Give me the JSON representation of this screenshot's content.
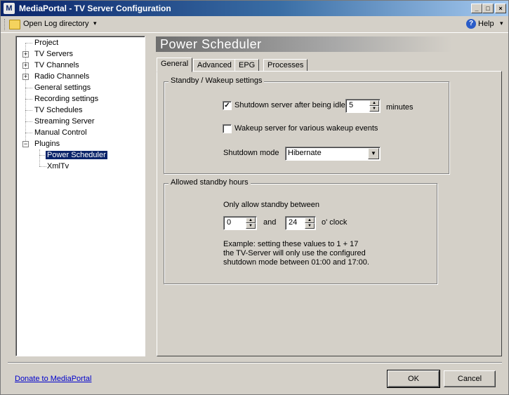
{
  "window": {
    "title": "MediaPortal - TV Server Configuration",
    "app_icon_glyph": "M",
    "minimize_glyph": "_",
    "maximize_glyph": "□",
    "close_glyph": "×"
  },
  "toolbar": {
    "open_log_label": "Open Log directory",
    "dropdown_glyph": "▾",
    "help_label": "Help",
    "help_icon_glyph": "?"
  },
  "tree": {
    "items": [
      {
        "label": "Project"
      },
      {
        "label": "TV Servers",
        "expander": "+"
      },
      {
        "label": "TV Channels",
        "expander": "+"
      },
      {
        "label": "Radio Channels",
        "expander": "+"
      },
      {
        "label": "General settings"
      },
      {
        "label": "Recording settings"
      },
      {
        "label": "TV Schedules"
      },
      {
        "label": "Streaming Server"
      },
      {
        "label": "Manual Control"
      },
      {
        "label": "Plugins",
        "expander": "−"
      },
      {
        "label": "Power Scheduler",
        "selected": true
      },
      {
        "label": "XmlTv"
      }
    ]
  },
  "page": {
    "header": "Power Scheduler"
  },
  "tabs": [
    "General",
    "Advanced",
    "EPG",
    "Processes"
  ],
  "standby_group": {
    "legend": "Standby / Wakeup settings",
    "shutdown_idle_label": "Shutdown server after being idle",
    "shutdown_idle_checked": true,
    "check_glyph": "✓",
    "idle_value": "5",
    "minutes_label": "minutes",
    "wakeup_label": "Wakeup server for various wakeup events",
    "wakeup_checked": false,
    "shutdown_mode_label": "Shutdown mode",
    "shutdown_mode_value": "Hibernate"
  },
  "hours_group": {
    "legend": "Allowed standby hours",
    "intro": "Only allow standby between",
    "from_value": "0",
    "and_label": "and",
    "to_value": "24",
    "oclock_label": "o' clock",
    "example_line1": "Example: setting these values to 1 + 17",
    "example_line2": "the TV-Server will only use the configured",
    "example_line3": "shutdown mode between 01:00 and 17:00."
  },
  "footer": {
    "donate_link": "Donate to MediaPortal",
    "ok_label": "OK",
    "cancel_label": "Cancel"
  },
  "spinner_glyphs": {
    "up": "▲",
    "down": "▼"
  },
  "colors": {
    "titlebar_start": "#0a246a",
    "titlebar_end": "#a6caf0",
    "selection": "#0a246a",
    "link": "#0000cc",
    "face": "#d4d0c8"
  }
}
